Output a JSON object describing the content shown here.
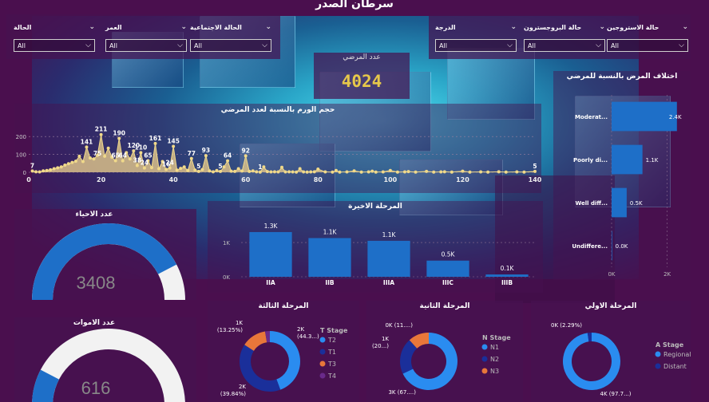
{
  "report_title": "سرطان الصدر",
  "slicers": [
    {
      "label": "الحالة",
      "value": "All"
    },
    {
      "label": "العمر",
      "value": "All"
    },
    {
      "label": "الحالة الاجتماعية",
      "value": "All"
    },
    {
      "label": "الدرجة",
      "value": "All"
    },
    {
      "label": "حالة البروجسترون",
      "value": "All"
    },
    {
      "label": "حالة الاستروجين",
      "value": "All"
    }
  ],
  "patients_card": {
    "label": "عدد المرضي",
    "value": "4024"
  },
  "alive_gauge": {
    "title": "عدد الاحياء",
    "value": "3408",
    "fraction": 0.847
  },
  "dead_gauge": {
    "title": "عدد الاموات",
    "value": "616",
    "fraction": 0.153
  },
  "colors": {
    "bar": "#1e6fc8",
    "gauge": "#1e6fc8",
    "gaugeBg": "#f2f2f2",
    "kpi": "#e6c84a",
    "line": "#f0d98a",
    "area": "#d9c08a"
  },
  "chart_data": [
    {
      "id": "tumor_size",
      "type": "area",
      "title": "حجم الورم بالنسبة لعدد المرضي",
      "xlim": [
        0,
        140
      ],
      "ylim": [
        0,
        250
      ],
      "xticks": [
        0,
        20,
        40,
        60,
        80,
        100,
        120,
        140
      ],
      "yticks": [
        0,
        100,
        200
      ],
      "ytick_labels": [
        "0",
        "100",
        "200"
      ],
      "points": [
        [
          1,
          7
        ],
        [
          2,
          3
        ],
        [
          3,
          2
        ],
        [
          4,
          8
        ],
        [
          5,
          10
        ],
        [
          6,
          14
        ],
        [
          7,
          20
        ],
        [
          8,
          25
        ],
        [
          9,
          30
        ],
        [
          10,
          40
        ],
        [
          11,
          48
        ],
        [
          12,
          55
        ],
        [
          13,
          62
        ],
        [
          14,
          90
        ],
        [
          15,
          60
        ],
        [
          16,
          141
        ],
        [
          17,
          80
        ],
        [
          18,
          75
        ],
        [
          19,
          95
        ],
        [
          20,
          211
        ],
        [
          21,
          90
        ],
        [
          22,
          135
        ],
        [
          23,
          85
        ],
        [
          24,
          65
        ],
        [
          25,
          190
        ],
        [
          26,
          64
        ],
        [
          27,
          110
        ],
        [
          28,
          75
        ],
        [
          29,
          120
        ],
        [
          30,
          38
        ],
        [
          31,
          110
        ],
        [
          32,
          24
        ],
        [
          33,
          65
        ],
        [
          34,
          26
        ],
        [
          35,
          161
        ],
        [
          36,
          20
        ],
        [
          37,
          60
        ],
        [
          38,
          16
        ],
        [
          39,
          24
        ],
        [
          40,
          145
        ],
        [
          41,
          12
        ],
        [
          42,
          22
        ],
        [
          43,
          30
        ],
        [
          44,
          10
        ],
        [
          45,
          77
        ],
        [
          46,
          12
        ],
        [
          47,
          5
        ],
        [
          48,
          15
        ],
        [
          49,
          93
        ],
        [
          50,
          8
        ],
        [
          51,
          3
        ],
        [
          52,
          10
        ],
        [
          53,
          5
        ],
        [
          54,
          30
        ],
        [
          55,
          64
        ],
        [
          56,
          6
        ],
        [
          57,
          5
        ],
        [
          58,
          20
        ],
        [
          59,
          7
        ],
        [
          60,
          92
        ],
        [
          61,
          5
        ],
        [
          62,
          8
        ],
        [
          63,
          3
        ],
        [
          64,
          1
        ],
        [
          65,
          30
        ],
        [
          66,
          4
        ],
        [
          67,
          2
        ],
        [
          68,
          3
        ],
        [
          69,
          2
        ],
        [
          70,
          28
        ],
        [
          71,
          2
        ],
        [
          72,
          3
        ],
        [
          73,
          2
        ],
        [
          74,
          1
        ],
        [
          75,
          20
        ],
        [
          76,
          2
        ],
        [
          77,
          1
        ],
        [
          78,
          2
        ],
        [
          79,
          3
        ],
        [
          80,
          18
        ],
        [
          82,
          2
        ],
        [
          84,
          1
        ],
        [
          85,
          10
        ],
        [
          86,
          1
        ],
        [
          88,
          2
        ],
        [
          90,
          8
        ],
        [
          92,
          1
        ],
        [
          94,
          2
        ],
        [
          95,
          6
        ],
        [
          96,
          1
        ],
        [
          98,
          2
        ],
        [
          100,
          10
        ],
        [
          102,
          1
        ],
        [
          104,
          2
        ],
        [
          105,
          4
        ],
        [
          107,
          1
        ],
        [
          110,
          5
        ],
        [
          112,
          1
        ],
        [
          114,
          2
        ],
        [
          115,
          3
        ],
        [
          117,
          1
        ],
        [
          120,
          6
        ],
        [
          122,
          1
        ],
        [
          125,
          2
        ],
        [
          127,
          1
        ],
        [
          130,
          3
        ],
        [
          132,
          1
        ],
        [
          135,
          2
        ],
        [
          137,
          1
        ],
        [
          140,
          5
        ]
      ],
      "labels": [
        [
          1,
          7,
          "7"
        ],
        [
          16,
          141,
          "141"
        ],
        [
          20,
          211,
          "211"
        ],
        [
          19,
          75,
          "75"
        ],
        [
          25,
          190,
          "190"
        ],
        [
          26,
          64,
          "64"
        ],
        [
          24,
          65,
          "65"
        ],
        [
          29,
          120,
          "120"
        ],
        [
          30,
          38,
          "38"
        ],
        [
          31,
          110,
          "110"
        ],
        [
          33,
          65,
          "65"
        ],
        [
          32,
          24,
          "24"
        ],
        [
          35,
          161,
          "161"
        ],
        [
          38,
          16,
          "16"
        ],
        [
          39,
          24,
          "24"
        ],
        [
          40,
          145,
          "145"
        ],
        [
          45,
          77,
          "77"
        ],
        [
          47,
          5,
          "5"
        ],
        [
          49,
          93,
          "93"
        ],
        [
          53,
          5,
          "5"
        ],
        [
          55,
          64,
          "64"
        ],
        [
          60,
          92,
          "92"
        ],
        [
          64,
          1,
          "1"
        ],
        [
          140,
          5,
          "5"
        ]
      ]
    },
    {
      "id": "differentiation",
      "type": "bar",
      "orientation": "horizontal",
      "title": "اختلاف المرض بالنسبة للمرضي",
      "categories": [
        "Moderat...",
        "Poorly di...",
        "Well diff...",
        "Undiffere..."
      ],
      "values": [
        2351,
        1111,
        543,
        19
      ],
      "value_labels": [
        "2.4K",
        "1.1K",
        "0.5K",
        "0.0K"
      ],
      "xlim": [
        0,
        2500
      ],
      "xticks": [
        0,
        2000
      ],
      "xtick_labels": [
        "0K",
        "2K"
      ]
    },
    {
      "id": "latest_stage",
      "type": "bar",
      "title": "المرحلة الاخيرة",
      "categories": [
        "IIA",
        "IIB",
        "IIIA",
        "IIIC",
        "IIIB"
      ],
      "values": [
        1305,
        1130,
        1050,
        472,
        67
      ],
      "value_labels": [
        "1.3K",
        "1.1K",
        "1.1K",
        "0.5K",
        "0.1K"
      ],
      "ylim": [
        0,
        1700
      ],
      "yticks": [
        0,
        1000
      ],
      "ytick_labels": [
        "0K",
        "1K"
      ]
    },
    {
      "id": "t_stage",
      "type": "pie",
      "title": "المرحلة الثالثة",
      "legend_title": "T Stage",
      "categories": [
        "T2",
        "T1",
        "T3",
        "T4"
      ],
      "values": [
        1786,
        1603,
        533,
        102
      ],
      "colors": [
        "#2a8cf0",
        "#1a2f9a",
        "#e8773a",
        "#6a2a8a"
      ],
      "slice_labels": [
        "2K\n(44.3...)",
        "2K\n(39.84%)",
        "1K\n(13.25%)",
        ""
      ]
    },
    {
      "id": "n_stage",
      "type": "pie",
      "title": "المرحلة الثانية",
      "legend_title": "N Stage",
      "categories": [
        "N1",
        "N2",
        "N3"
      ],
      "values": [
        2732,
        820,
        472
      ],
      "colors": [
        "#2a8cf0",
        "#1a2f9a",
        "#e8773a"
      ],
      "slice_labels": [
        "3K (67....)",
        "1K\n(20...)",
        "0K (11....)"
      ]
    },
    {
      "id": "a_stage",
      "type": "pie",
      "title": "المرحلة الاولي",
      "legend_title": "A Stage",
      "categories": [
        "Regional",
        "Distant"
      ],
      "values": [
        3932,
        92
      ],
      "colors": [
        "#2a8cf0",
        "#1a2f9a"
      ],
      "slice_labels": [
        "4K (97.7...)",
        "0K (2.29%)"
      ]
    }
  ]
}
